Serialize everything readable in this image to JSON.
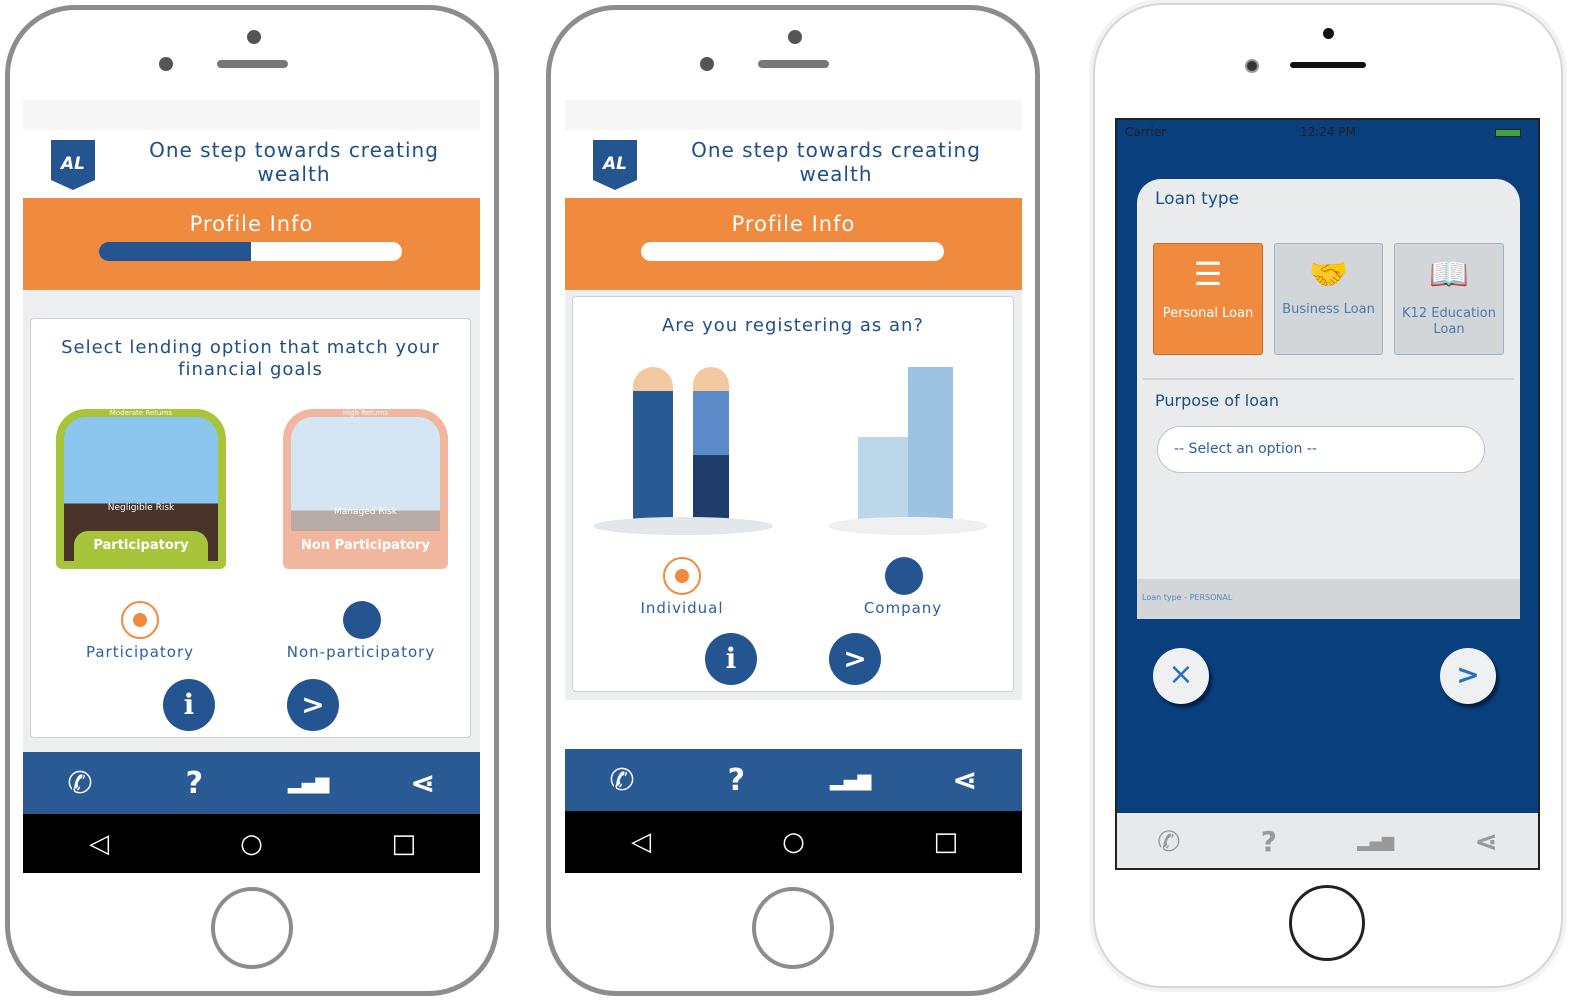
{
  "header": {
    "tagline": "One step towards creating wealth",
    "logo": "AL",
    "section_title": "Profile Info"
  },
  "screen1": {
    "progress": 0.5,
    "question": "Select lending option that match your financial goals",
    "options": [
      {
        "label": "Participatory",
        "image_title": "Participatory",
        "image_caption": "Negligible Risk",
        "image_ribbon": "Moderate Returns",
        "selected": true
      },
      {
        "label": "Non-participatory",
        "image_title": "Non Participatory",
        "image_caption": "Managed Risk",
        "image_ribbon": "High Returns",
        "selected": false
      }
    ],
    "info_icon": "i",
    "next_icon": ">"
  },
  "screen2": {
    "progress": 0,
    "question": "Are you registering as an?",
    "options": [
      {
        "label": "Individual",
        "selected": true
      },
      {
        "label": "Company",
        "selected": false
      }
    ],
    "info_icon": "i",
    "next_icon": ">"
  },
  "bottom_nav": [
    {
      "icon": "phone-icon",
      "glyph": "✆"
    },
    {
      "icon": "help-icon",
      "glyph": "?"
    },
    {
      "icon": "stats-icon",
      "glyph": "▂▄▆"
    },
    {
      "icon": "share-icon",
      "glyph": "⋖"
    }
  ],
  "android_nav": {
    "back": "◁",
    "home": "○",
    "recent": "□"
  },
  "screen3": {
    "status": {
      "carrier": "Carrier",
      "time": "12:24 PM"
    },
    "loan_type_label": "Loan type",
    "loan_types": [
      {
        "label": "Personal Loan",
        "icon": "person-list-icon",
        "glyph": "☰",
        "selected": true
      },
      {
        "label": "Business Loan",
        "icon": "handshake-icon",
        "glyph": "🤝",
        "selected": false
      },
      {
        "label": "K12 Education Loan",
        "icon": "book-icon",
        "glyph": "📖",
        "selected": false
      }
    ],
    "purpose_label": "Purpose of loan",
    "purpose_select": "-- Select an option --",
    "footer_text": "Loan type - PERSONAL",
    "cancel_icon": "×",
    "next_icon": ">"
  },
  "colors": {
    "orange": "#f08a3e",
    "blue": "#245590",
    "ios_blue": "#0a3f7e"
  }
}
